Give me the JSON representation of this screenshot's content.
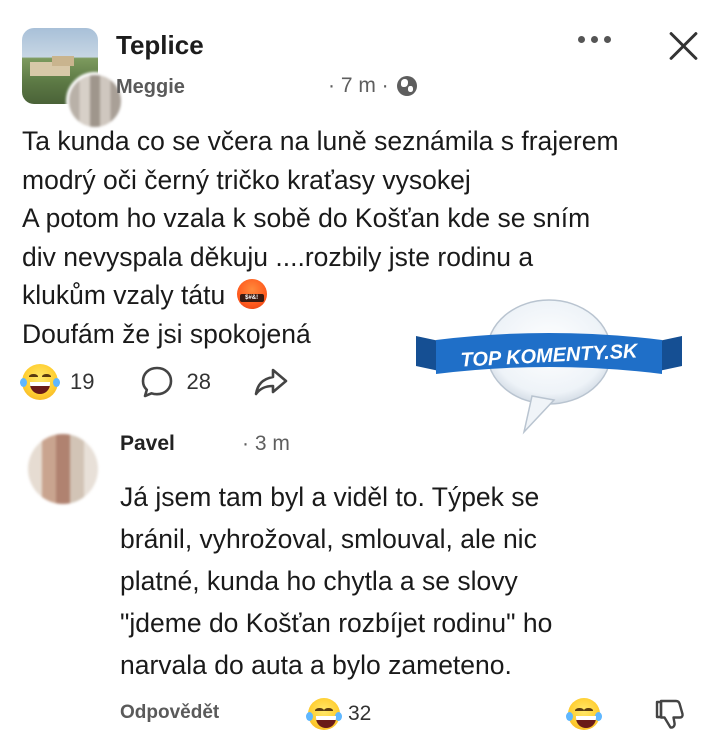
{
  "post": {
    "group_name": "Teplice",
    "author": "Meggie",
    "time": "· 7 m ·",
    "body_lines": [
      "Ta kunda co se včera na luně seznámila s frajerem",
      "modrý oči černý tričko kraťasy  vysokej",
      "A potom ho vzala k sobě do Košťan kde se sním",
      "div nevyspala děkuju ....rozbily jste rodinu a",
      "klukům vzaly tátu",
      "Doufám že jsi spokojená"
    ],
    "reaction_count": "19",
    "comment_count": "28"
  },
  "watermark": {
    "text": "TOP KOMENTY.SK"
  },
  "comment": {
    "author": "Pavel",
    "time": "· 3 m",
    "lines": [
      "Já jsem tam byl a viděl to. Týpek se",
      "bránil, vyhrožoval, smlouval, ale nic",
      "platné, kunda ho chytla a se slovy",
      "\"jdeme do Košťan rozbíjet rodinu\" ho",
      "narvala do auta a bylo zameteno."
    ],
    "reply_label": "Odpovědět",
    "reaction_count": "32"
  },
  "icons": {
    "more": "more-dots-icon",
    "close": "close-icon",
    "globe": "globe-icon",
    "reaction": "laughing-face-icon",
    "comment": "comment-bubble-icon",
    "share": "share-arrow-icon",
    "dislike": "thumbs-down-icon",
    "angry": "angry-swearing-face-icon"
  },
  "colors": {
    "watermark_ribbon": "#1f6fc8",
    "text_primary": "#1a1a1a",
    "text_secondary": "#5e5e5e"
  }
}
